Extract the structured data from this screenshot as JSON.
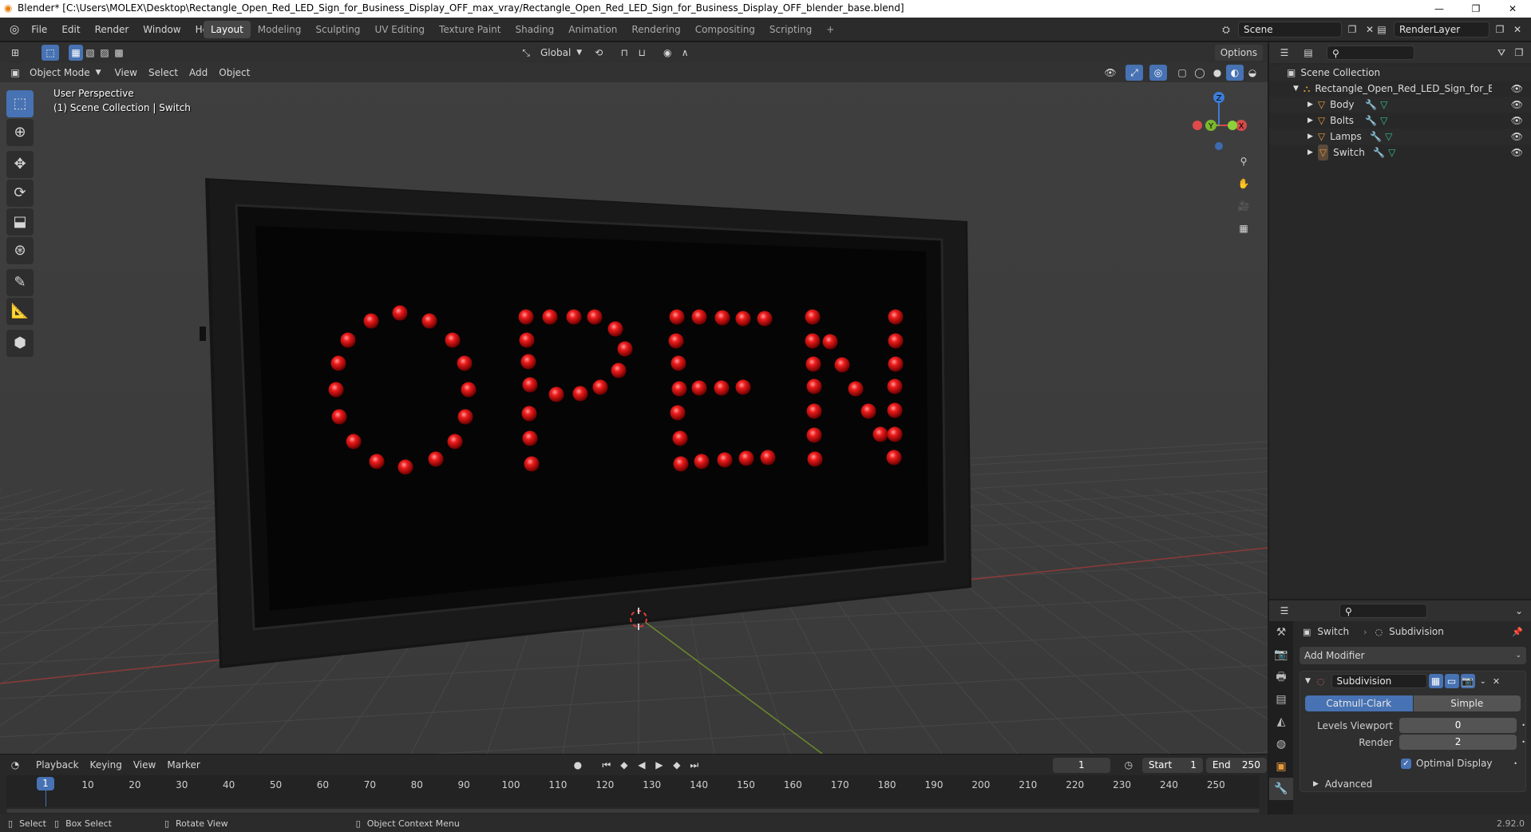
{
  "titlebar": {
    "title": "Blender* [C:\\Users\\MOLEX\\Desktop\\Rectangle_Open_Red_LED_Sign_for_Business_Display_OFF_max_vray/Rectangle_Open_Red_LED_Sign_for_Business_Display_OFF_blender_base.blend]",
    "minimize": "—",
    "restore": "❐",
    "close": "✕"
  },
  "menu": [
    "File",
    "Edit",
    "Render",
    "Window",
    "Help"
  ],
  "workspaces": [
    "Layout",
    "Modeling",
    "Sculpting",
    "UV Editing",
    "Texture Paint",
    "Shading",
    "Animation",
    "Rendering",
    "Compositing",
    "Scripting",
    "+"
  ],
  "scene": {
    "name": "Scene",
    "render_layer": "RenderLayer"
  },
  "viewport": {
    "mode": "Object Mode",
    "menus": [
      "View",
      "Select",
      "Add",
      "Object"
    ],
    "orientation": "Global",
    "options": "Options",
    "perspective_label": "User Perspective",
    "collection_label": "(1) Scene Collection | Switch",
    "gizmo": {
      "z": "Z",
      "y": "Y",
      "x": "X"
    },
    "sign_text": "OPEN"
  },
  "outliner": {
    "root": "Scene Collection",
    "object": "Rectangle_Open_Red_LED_Sign_for_Business",
    "children": [
      "Body",
      "Bolts",
      "Lamps",
      "Switch"
    ]
  },
  "properties": {
    "object": "Switch",
    "modifier_breadcrumb": "Subdivision",
    "add_modifier": "Add Modifier",
    "modifier_name": "Subdivision",
    "type_a": "Catmull-Clark",
    "type_b": "Simple",
    "levels_viewport_label": "Levels Viewport",
    "levels_viewport": "0",
    "render_label": "Render",
    "render": "2",
    "optimal_display": "Optimal Display",
    "advanced": "Advanced"
  },
  "timeline": {
    "menus": [
      "Playback",
      "Keying",
      "View",
      "Marker"
    ],
    "current_frame": "1",
    "start_label": "Start",
    "start": "1",
    "end_label": "End",
    "end": "250",
    "ticks": [
      "1",
      "10",
      "20",
      "30",
      "40",
      "50",
      "60",
      "70",
      "80",
      "90",
      "100",
      "110",
      "120",
      "130",
      "140",
      "150",
      "160",
      "170",
      "180",
      "190",
      "200",
      "210",
      "220",
      "230",
      "240",
      "250"
    ]
  },
  "status": {
    "select": "Select",
    "box_select": "Box Select",
    "rotate": "Rotate View",
    "context": "Object Context Menu",
    "version": "2.92.0"
  }
}
